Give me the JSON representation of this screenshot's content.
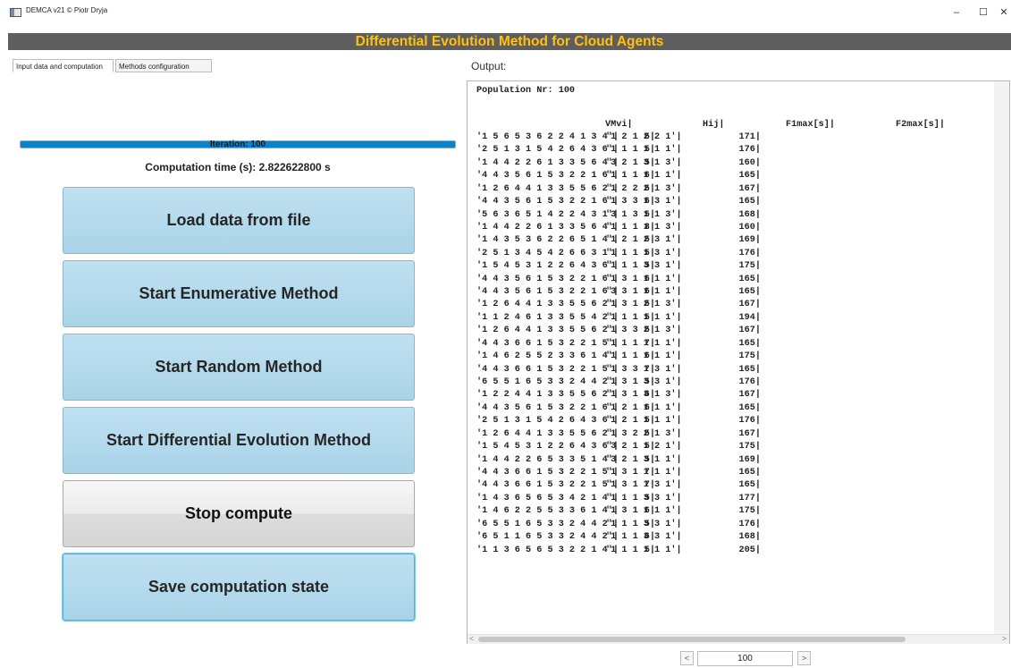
{
  "window": {
    "title": "DEMCA v21 © Piotr Dryja",
    "min_glyph": "–",
    "max_glyph": "☐",
    "close_glyph": "✕"
  },
  "header": {
    "title": "Differential Evolution Method for Cloud Agents"
  },
  "tabs": [
    {
      "label": "Input data and computation",
      "active": true
    },
    {
      "label": "Methods configuration",
      "active": false
    }
  ],
  "progress": {
    "label": "Iteration: 100",
    "fraction": 1.0
  },
  "computation_time": "Computation time (s): 2.822622800 s",
  "buttons": {
    "load": "Load data from file",
    "enumerative": "Start Enumerative Method",
    "random": "Start Random Method",
    "differential": "Start Differential Evolution Method",
    "stop": "Stop compute",
    "save": "Save computation state"
  },
  "output": {
    "label": "Output:",
    "population": "Population Nr: 100",
    "columns": {
      "vm": "VMvi|",
      "hij": "Hij|",
      "f1": "F1max[s]|",
      "f2": "F2max[s]|"
    },
    "rows": [
      [
        "'1 5 6 5 3 6 2 2 4 1 3 4'|",
        "'1 2 1 2 2 1'|",
        "5|",
        "171|"
      ],
      [
        "'2 5 1 3 1 5 4 2 6 4 3 6'|",
        "'1 1 1 1 1 1'|",
        "5|",
        "176|"
      ],
      [
        "'1 4 4 2 2 6 1 3 3 5 6 4'|",
        "'3 2 1 3 1 3'|",
        "5|",
        "160|"
      ],
      [
        "'4 4 3 5 6 1 5 3 2 2 1 6'|",
        "'1 1 1 1 1 1'|",
        "6|",
        "165|"
      ],
      [
        "'1 2 6 4 4 1 3 3 5 5 6 2'|",
        "'1 2 2 2 1 3'|",
        "5|",
        "167|"
      ],
      [
        "'4 4 3 5 6 1 5 3 2 2 1 6'|",
        "'1 3 3 1 3 1'|",
        "6|",
        "165|"
      ],
      [
        "'5 6 3 6 5 1 4 2 2 4 3 1'|",
        "'3 1 3 1 1 3'|",
        "5|",
        "168|"
      ],
      [
        "'1 4 4 2 2 6 1 3 3 5 6 4'|",
        "'1 1 1 1 1 3'|",
        "8|",
        "160|"
      ],
      [
        "'1 4 3 5 3 6 2 2 6 5 1 4'|",
        "'1 2 1 2 3 1'|",
        "5|",
        "169|"
      ],
      [
        "'2 5 1 3 4 5 4 2 6 6 3 1'|",
        "'1 1 1 1 3 1'|",
        "5|",
        "176|"
      ],
      [
        "'1 5 4 5 3 1 2 2 6 4 3 6'|",
        "'1 1 1 3 3 1'|",
        "5|",
        "175|"
      ],
      [
        "'4 4 3 5 6 1 5 3 2 2 1 6'|",
        "'1 3 1 1 1 1'|",
        "6|",
        "165|"
      ],
      [
        "'4 4 3 5 6 1 5 3 2 2 1 6'|",
        "'3 3 1 1 1 1'|",
        "6|",
        "165|"
      ],
      [
        "'1 2 6 4 4 1 3 3 5 5 6 2'|",
        "'1 3 1 2 1 3'|",
        "5|",
        "167|"
      ],
      [
        "'1 1 2 4 6 1 3 3 5 5 4 2'|",
        "'1 1 1 1 1 1'|",
        "5|",
        "194|"
      ],
      [
        "'1 2 6 4 4 1 3 3 5 5 6 2'|",
        "'1 3 3 2 1 3'|",
        "5|",
        "167|"
      ],
      [
        "'4 4 3 6 6 1 5 3 2 2 1 5'|",
        "'1 1 1 1 1 1'|",
        "7|",
        "165|"
      ],
      [
        "'1 4 6 2 5 5 2 3 3 6 1 4'|",
        "'1 1 1 1 1 1'|",
        "6|",
        "175|"
      ],
      [
        "'4 4 3 6 6 1 5 3 2 2 1 5'|",
        "'1 3 3 1 3 1'|",
        "7|",
        "165|"
      ],
      [
        "'6 5 5 1 6 5 3 3 2 4 4 2'|",
        "'1 3 1 3 3 1'|",
        "5|",
        "176|"
      ],
      [
        "'1 2 2 4 4 1 3 3 5 5 6 2'|",
        "'1 3 1 3 1 3'|",
        "6|",
        "167|"
      ],
      [
        "'4 4 3 5 6 1 5 3 2 2 1 6'|",
        "'1 2 1 1 1 1'|",
        "6|",
        "165|"
      ],
      [
        "'2 5 1 3 1 5 4 2 6 4 3 6'|",
        "'1 2 1 1 1 1'|",
        "5|",
        "176|"
      ],
      [
        "'1 2 6 4 4 1 3 3 5 5 6 2'|",
        "'1 3 2 2 1 3'|",
        "5|",
        "167|"
      ],
      [
        "'1 5 4 5 3 1 2 2 6 4 3 6'|",
        "'3 2 1 1 2 1'|",
        "5|",
        "175|"
      ],
      [
        "'1 4 4 2 2 6 5 3 3 5 1 4'|",
        "'3 2 1 3 1 1'|",
        "5|",
        "169|"
      ],
      [
        "'4 4 3 6 6 1 5 3 2 2 1 5'|",
        "'1 3 1 1 1 1'|",
        "7|",
        "165|"
      ],
      [
        "'4 4 3 6 6 1 5 3 2 2 1 5'|",
        "'1 3 1 1 3 1'|",
        "7|",
        "165|"
      ],
      [
        "'1 4 3 6 5 6 5 3 4 2 1 4'|",
        "'1 1 1 3 3 1'|",
        "5|",
        "177|"
      ],
      [
        "'1 4 6 2 2 5 5 3 3 6 1 4'|",
        "'1 3 1 1 1 1'|",
        "6|",
        "175|"
      ],
      [
        "'6 5 5 1 6 5 3 3 2 4 4 2'|",
        "'1 1 1 3 3 1'|",
        "5|",
        "176|"
      ],
      [
        "'6 5 1 1 6 5 3 3 2 4 4 2'|",
        "'1 1 1 3 3 1'|",
        "6|",
        "168|"
      ],
      [
        "'1 1 3 6 5 6 5 3 2 2 1 4'|",
        "'1 1 1 1 1 1'|",
        "5|",
        "205|"
      ]
    ]
  },
  "pager": {
    "value": "100",
    "prev_glyph": "<",
    "next_glyph": ">"
  }
}
